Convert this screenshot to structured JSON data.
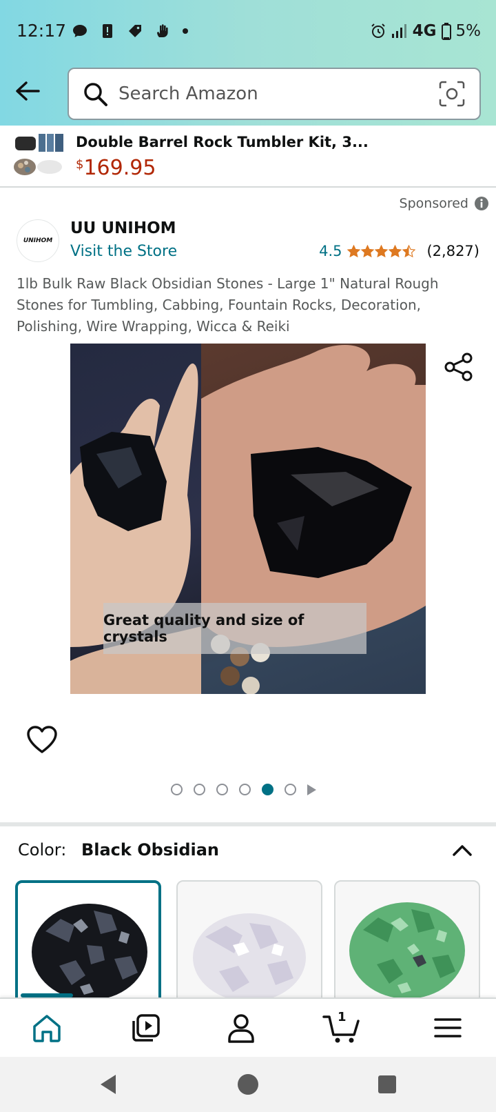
{
  "status_bar": {
    "time": "12:17",
    "network": "4G",
    "battery": "5%"
  },
  "search": {
    "placeholder": "Search Amazon"
  },
  "mini_product": {
    "title": "Double Barrel Rock Tumbler Kit, 3...",
    "price_symbol": "$",
    "price_amount": "169.95"
  },
  "sponsored_label": "Sponsored",
  "brand": {
    "logo_text": "UNIHOM",
    "name": "UU UNIHOM",
    "visit_store": "Visit the Store"
  },
  "rating": {
    "value": "4.5",
    "stars": 4.5,
    "count": "(2,827)",
    "star_color": "#de7921"
  },
  "product_title": "1lb Bulk Raw Black Obsidian Stones - Large 1\" Natural Rough Stones for Tumbling, Cabbing, Fountain Rocks, Decoration, Polishing, Wire Wrapping, Wicca & Reiki",
  "image_caption": "Great quality and size of crystals",
  "carousel": {
    "total": 6,
    "active_index": 4
  },
  "color": {
    "label": "Color:",
    "value": "Black Obsidian"
  },
  "swatches": [
    {
      "name": "black-obsidian",
      "selected": true
    },
    {
      "name": "clear-quartz",
      "selected": false
    },
    {
      "name": "green-fluorite",
      "selected": false
    }
  ],
  "bottom_nav": {
    "cart_count": "1",
    "accent": "#007185"
  },
  "colors": {
    "link": "#007185",
    "price": "#b12704",
    "header_gradient": [
      "#82d8e3",
      "#a8e5d3"
    ]
  }
}
